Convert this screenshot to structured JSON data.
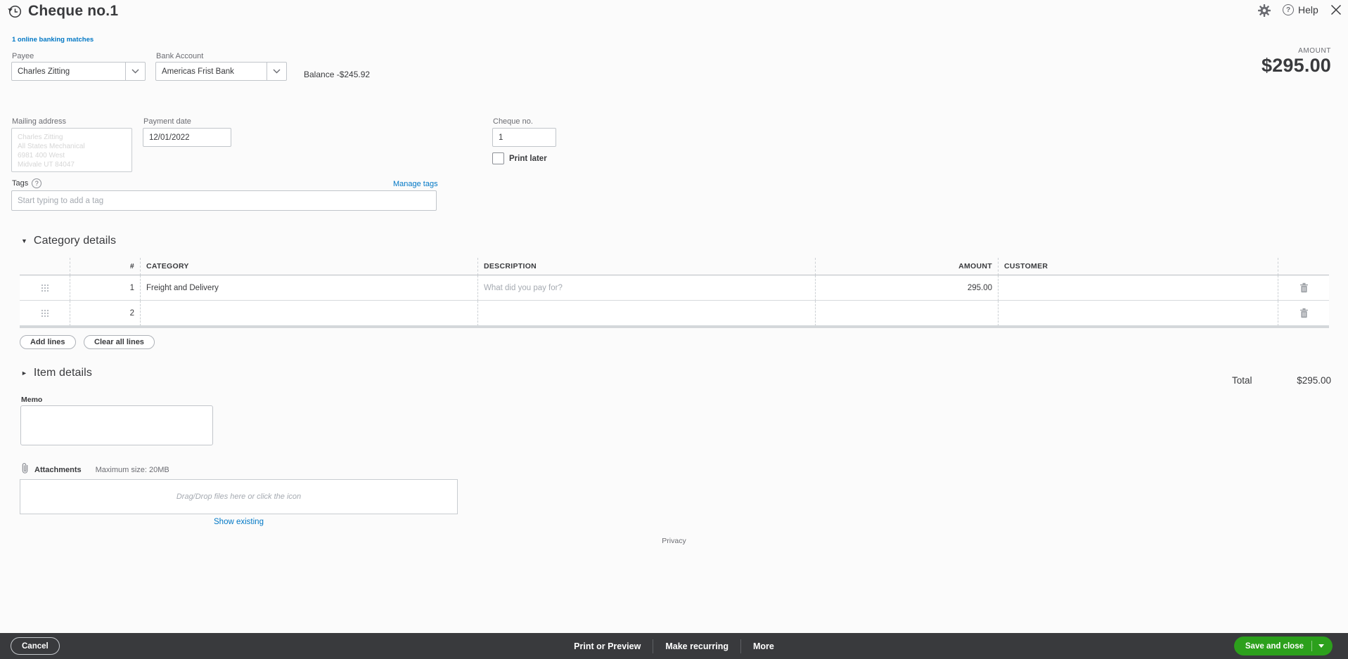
{
  "header": {
    "title": "Cheque no.1",
    "help_label": "Help",
    "icons": {
      "history": "clock-with-arrow",
      "gear": "settings",
      "help": "?",
      "close": "x"
    }
  },
  "banking_link": "1 online banking matches",
  "payee": {
    "label": "Payee",
    "value": "Charles Zitting"
  },
  "bank_account": {
    "label": "Bank Account",
    "value": "Americas Frist Bank",
    "balance_text": "Balance -$245.92"
  },
  "amount_header": {
    "label": "AMOUNT",
    "value": "$295.00"
  },
  "mailing_address": {
    "label": "Mailing address",
    "lines": [
      "Charles Zitting",
      "All States Mechanical",
      "6981 400 West",
      "Midvale UT 84047"
    ]
  },
  "payment_date": {
    "label": "Payment date",
    "value": "12/01/2022"
  },
  "cheque_no": {
    "label": "Cheque no.",
    "value": "1"
  },
  "print_later": {
    "label": "Print later",
    "checked": false
  },
  "tags": {
    "label": "Tags",
    "help_glyph": "?",
    "manage_link": "Manage tags",
    "placeholder": "Start typing to add a tag"
  },
  "category_details": {
    "title": "Category details",
    "open_glyph": "▼",
    "columns": {
      "num": "#",
      "category": "CATEGORY",
      "description": "DESCRIPTION",
      "amount": "AMOUNT",
      "customer": "CUSTOMER"
    },
    "rows": [
      {
        "num": "1",
        "category": "Freight and Delivery",
        "description_placeholder": "What did you pay for?",
        "amount": "295.00",
        "customer": ""
      },
      {
        "num": "2",
        "category": "",
        "description_placeholder": "",
        "amount": "",
        "customer": ""
      }
    ],
    "add_lines_label": "Add lines",
    "clear_all_label": "Clear all lines"
  },
  "item_details": {
    "title": "Item details",
    "closed_glyph": "►"
  },
  "total": {
    "label": "Total",
    "value": "$295.00"
  },
  "memo": {
    "label": "Memo",
    "value": ""
  },
  "attachments": {
    "label": "Attachments",
    "max_size_text": "Maximum size: 20MB",
    "dropzone_text": "Drag/Drop files here or click the icon",
    "show_existing_label": "Show existing"
  },
  "privacy_label": "Privacy",
  "footer": {
    "cancel_label": "Cancel",
    "print_label": "Print or Preview",
    "recurring_label": "Make recurring",
    "more_label": "More",
    "save_label": "Save and close"
  },
  "colors": {
    "accent_green": "#2ca01c",
    "link_blue": "#0077c5",
    "footer_bg": "#393a3d",
    "text_dark": "#393a3d"
  }
}
